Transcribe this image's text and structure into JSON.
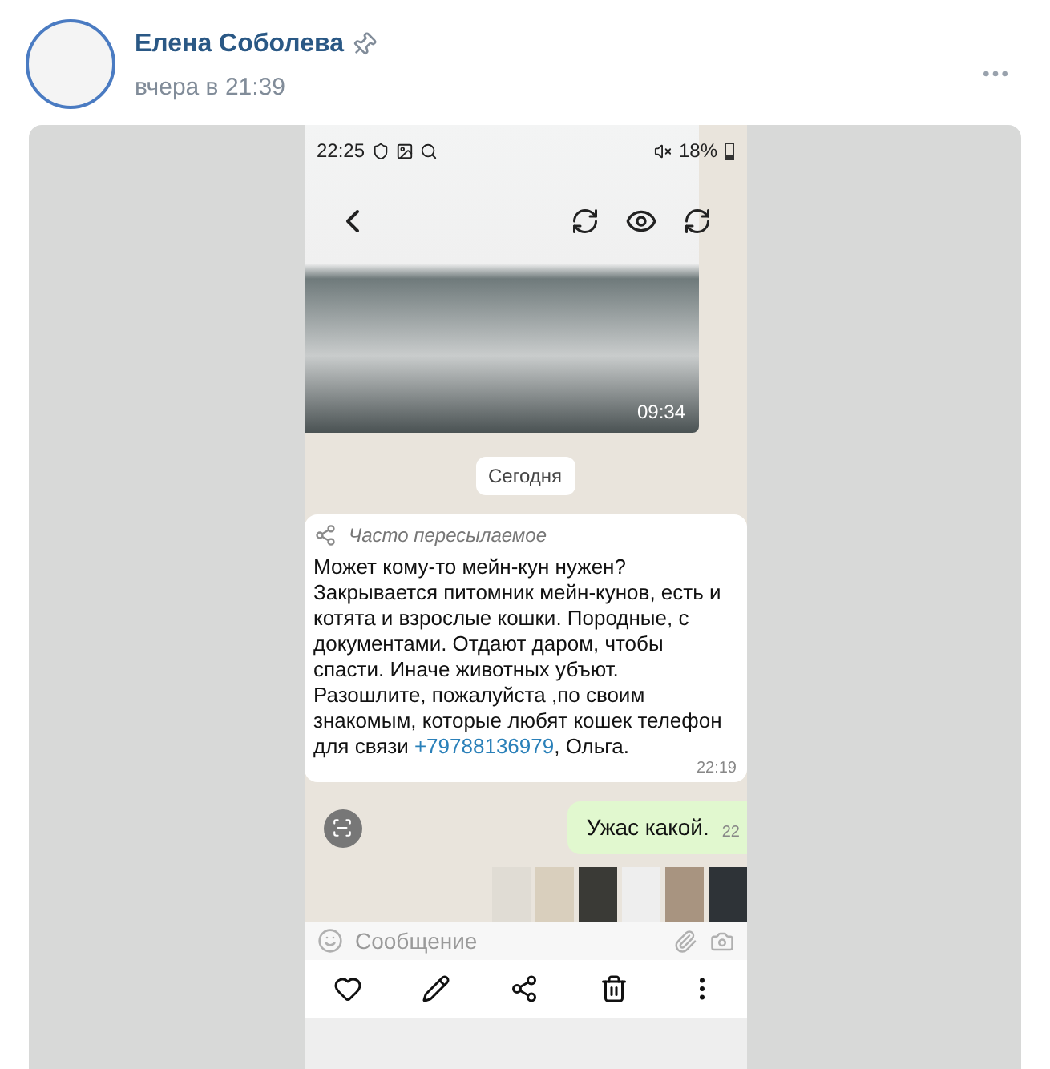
{
  "post": {
    "author": "Елена Соболева",
    "pinned": true,
    "time": "вчера в 21:39"
  },
  "phone": {
    "status_time": "22:25",
    "battery": "18%",
    "video_duration": "09:34",
    "date_chip": "Сегодня",
    "forwarded_label": "Часто пересылаемое",
    "message_before": "Может кому-то мейн-кун нужен? Закрывается питомник мейн-кунов, есть и котята и взрослые кошки. Породные, с документами. Отдают даром, чтобы спасти. Иначе животных убъют. Разошлите, пожалуйста ,по своим знакомым, которые любят кошек телефон для связи ",
    "message_link": "+79788136979",
    "message_after": ", Ольга.",
    "message_time": "22:19",
    "reply": "Ужас какой.",
    "reply_time": "22",
    "input_placeholder": "Сообщение"
  }
}
